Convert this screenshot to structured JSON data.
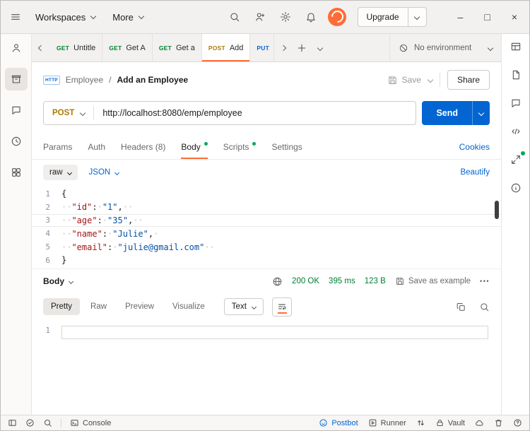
{
  "colors": {
    "orange": "#ff6c37",
    "blue": "#0265d2",
    "green": "#007f31",
    "method_post": "#ad7a03"
  },
  "topbar": {
    "workspaces_label": "Workspaces",
    "more_label": "More",
    "upgrade_label": "Upgrade",
    "window": {
      "minimize": "–",
      "maximize": "□",
      "close": "×"
    }
  },
  "tabstrip": {
    "tabs": [
      {
        "method": "GET",
        "label": "Untitle"
      },
      {
        "method": "GET",
        "label": "Get A"
      },
      {
        "method": "GET",
        "label": "Get a"
      },
      {
        "method": "POST",
        "label": "Add"
      },
      {
        "method": "PUT",
        "label": ""
      }
    ],
    "environment": "No environment"
  },
  "request": {
    "badge": "HTTP",
    "breadcrumb": {
      "collection": "Employee",
      "separator": "/",
      "name": "Add an Employee"
    },
    "save_label": "Save",
    "share_label": "Share",
    "method": "POST",
    "url": "http://localhost:8080/emp/employee",
    "send_label": "Send",
    "tabs": [
      "Params",
      "Auth",
      "Headers (8)",
      "Body",
      "Scripts",
      "Settings"
    ],
    "cookies_label": "Cookies",
    "body_type": "raw",
    "body_format": "JSON",
    "beautify_label": "Beautify",
    "editor": {
      "active_line": 3,
      "lines": [
        [
          [
            "p",
            "{"
          ]
        ],
        [
          [
            "w",
            "··"
          ],
          [
            "k",
            "\"id\""
          ],
          [
            "p",
            ":"
          ],
          [
            "w",
            "·"
          ],
          [
            "s",
            "\"1\""
          ],
          [
            "p",
            ","
          ],
          [
            "w",
            "··"
          ]
        ],
        [
          [
            "w",
            "··"
          ],
          [
            "k",
            "\"age\""
          ],
          [
            "p",
            ":"
          ],
          [
            "w",
            "·"
          ],
          [
            "s",
            "\"35\""
          ],
          [
            "p",
            ","
          ],
          [
            "w",
            "··"
          ]
        ],
        [
          [
            "w",
            "··"
          ],
          [
            "k",
            "\"name\""
          ],
          [
            "p",
            ":"
          ],
          [
            "w",
            "·"
          ],
          [
            "s",
            "\"Julie\""
          ],
          [
            "p",
            ","
          ],
          [
            "w",
            "·"
          ]
        ],
        [
          [
            "w",
            "··"
          ],
          [
            "k",
            "\"email\""
          ],
          [
            "p",
            ":"
          ],
          [
            "w",
            "·"
          ],
          [
            "s",
            "\"julie@gmail.com\""
          ],
          [
            "w",
            "··"
          ]
        ],
        [
          [
            "p",
            "}"
          ]
        ]
      ]
    }
  },
  "response": {
    "body_label": "Body",
    "status": "200 OK",
    "time": "395 ms",
    "size": "123 B",
    "save_example_label": "Save as example",
    "view_tabs": [
      "Pretty",
      "Raw",
      "Preview",
      "Visualize"
    ],
    "format": "Text",
    "editor_line": "1"
  },
  "statusbar": {
    "console_label": "Console",
    "postbot_label": "Postbot",
    "runner_label": "Runner",
    "vault_label": "Vault"
  }
}
